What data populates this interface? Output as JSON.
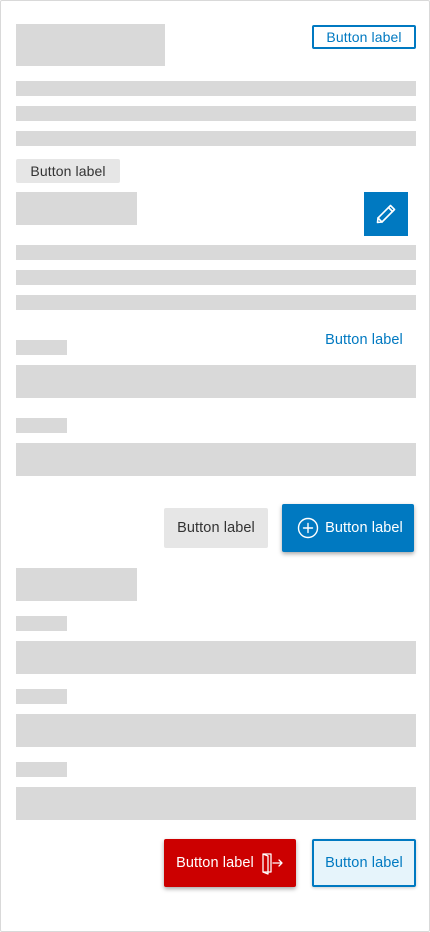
{
  "header": {
    "action_label": "Button label"
  },
  "section1": {
    "chip_label": "Button label",
    "edit_icon": "pencil-icon"
  },
  "section2": {
    "link_label": "Button label"
  },
  "actions1": {
    "secondary_label": "Button label",
    "primary_label": "Button label",
    "primary_icon": "plus-circle-icon"
  },
  "actions2": {
    "danger_label": "Button label",
    "danger_icon": "exit-door-icon",
    "outline_label": "Button label"
  },
  "colors": {
    "brand_blue": "#0079c1",
    "danger_red": "#cc0000",
    "placeholder_gray": "#d9d9d9",
    "secondary_gray": "#e6e6e6",
    "outline_fill": "#e6f4fb"
  }
}
